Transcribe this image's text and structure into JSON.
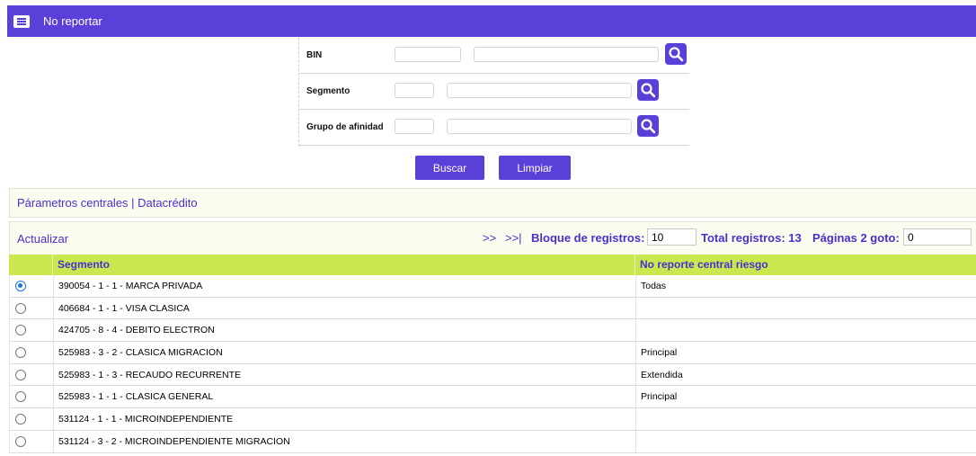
{
  "header": {
    "title": "No reportar",
    "icon": "list-icon"
  },
  "filters": {
    "bin": {
      "label": "BIN",
      "code_value": "",
      "desc_value": ""
    },
    "segmento": {
      "label": "Segmento",
      "code_value": "",
      "desc_value": ""
    },
    "grupo": {
      "label": "Grupo de afinidad",
      "code_value": "",
      "desc_value": ""
    }
  },
  "actions": {
    "buscar": "Buscar",
    "limpiar": "Limpiar"
  },
  "section": {
    "label": "Párametros centrales | Datacrédito"
  },
  "toolbar": {
    "actualizar": "Actualizar",
    "next": ">>",
    "last": ">>|",
    "bloque_label": "Bloque de registros:",
    "bloque_value": "10",
    "total": "Total registros: 13",
    "paginas_label": "Páginas 2 goto:",
    "goto_value": "0"
  },
  "table": {
    "columns": [
      "Segmento",
      "No reporte central riesgo"
    ],
    "rows": [
      {
        "segmento": "390054 - 1 - 1 - MARCA PRIVADA",
        "reporte": "Todas",
        "selected": true
      },
      {
        "segmento": "406684 - 1 - 1 - VISA CLASICA",
        "reporte": "",
        "selected": false
      },
      {
        "segmento": "424705 - 8 - 4 - DEBITO ELECTRON",
        "reporte": "",
        "selected": false
      },
      {
        "segmento": "525983 - 3 - 2 - CLASICA MIGRACION",
        "reporte": "Principal",
        "selected": false
      },
      {
        "segmento": "525983 - 1 - 3 - RECAUDO RECURRENTE",
        "reporte": "Extendida",
        "selected": false
      },
      {
        "segmento": "525983 - 1 - 1 - CLASICA GENERAL",
        "reporte": "Principal",
        "selected": false
      },
      {
        "segmento": "531124 - 1 - 1 - MICROINDEPENDIENTE",
        "reporte": "",
        "selected": false
      },
      {
        "segmento": "531124 - 3 - 2 - MICROINDEPENDIENTE MIGRACION",
        "reporte": "",
        "selected": false
      }
    ]
  },
  "colors": {
    "accent": "#5b3fd9",
    "header_row": "#c9e84f",
    "link": "#4a2fcf",
    "panel": "#fbfcef"
  }
}
